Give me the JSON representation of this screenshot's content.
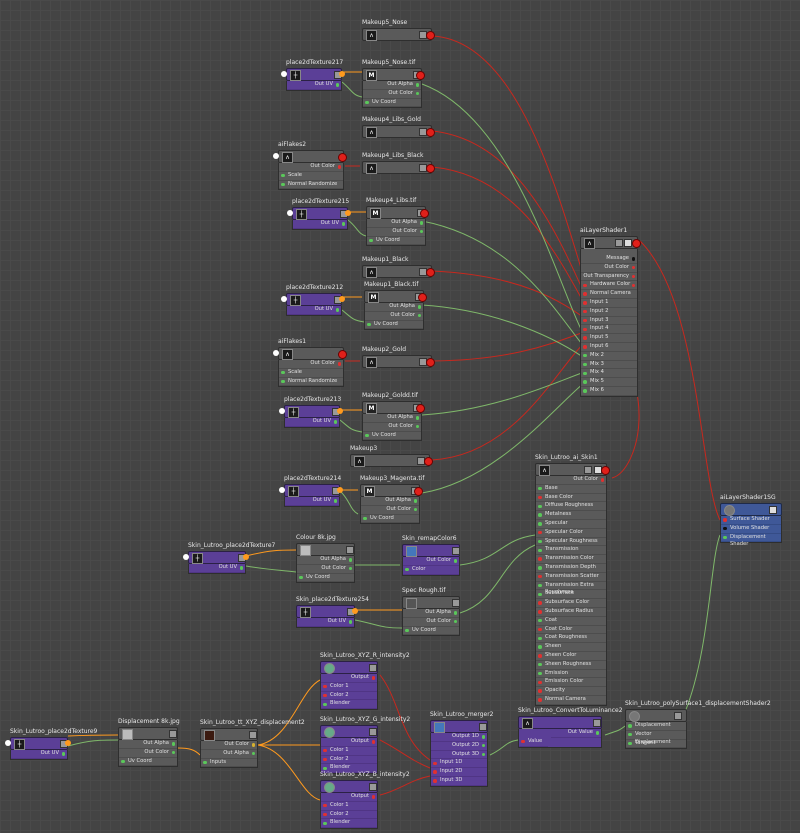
{
  "nodes": {
    "makeup5_nose": {
      "title": "Makeup5_Nose"
    },
    "place2d217": {
      "title": "place2dTexture217",
      "out": "Out UV"
    },
    "makeup5_nose_tif": {
      "title": "Makeup5_Nose.tif",
      "out_alpha": "Out Alpha",
      "out_color": "Out Color",
      "uv": "Uv Coord"
    },
    "makeup4_libs_gold": {
      "title": "Makeup4_Libs_Gold"
    },
    "aiflakes2": {
      "title": "aiFlakes2",
      "out": "Out Color",
      "scale": "Scale",
      "normal_randomize": "Normal Randomize"
    },
    "makeup4_libs_black": {
      "title": "Makeup4_Libs_Black"
    },
    "place2d215": {
      "title": "place2dTexture215",
      "out": "Out UV"
    },
    "makeup4_libs_tif": {
      "title": "Makeup4_Libs.tif",
      "out_alpha": "Out Alpha",
      "out_color": "Out Color",
      "uv": "Uv Coord"
    },
    "makeup1_black": {
      "title": "Makeup1_Black"
    },
    "place2d212": {
      "title": "place2dTexture212",
      "out": "Out UV"
    },
    "makeup1_black_tif": {
      "title": "Makeup1_Black.tif",
      "out_alpha": "Out Alpha",
      "out_color": "Out Color",
      "uv": "Uv Coord"
    },
    "aiflakes1": {
      "title": "aiFlakes1",
      "out": "Out Color",
      "scale": "Scale",
      "normal_randomize": "Normal Randomize"
    },
    "makeup2_gold": {
      "title": "Makeup2_Gold"
    },
    "place2d213": {
      "title": "place2dTexture213",
      "out": "Out UV"
    },
    "makeup2_goldd_tif": {
      "title": "Makeup2_Goldd.tif",
      "out_alpha": "Out Alpha",
      "out_color": "Out Color",
      "uv": "Uv Coord"
    },
    "makeup3": {
      "title": "Makeup3"
    },
    "place2d214": {
      "title": "place2dTexture214",
      "out": "Out UV"
    },
    "makeup3_magenta_tif": {
      "title": "Makeup3_Magenta.tif",
      "out_alpha": "Out Alpha",
      "out_color": "Out Color",
      "uv": "Uv Coord"
    },
    "ailayershader1": {
      "title": "aiLayerShader1",
      "rows": [
        "Message",
        "Out Color",
        "Out Transparency",
        "Hardware Color",
        "Normal Camera",
        "Input 1",
        "Input 2",
        "Input 3",
        "Input 4",
        "Input 5",
        "Input 6",
        "Mix 2",
        "Mix 3",
        "Mix 4",
        "Mix 5",
        "Mix 6"
      ]
    },
    "skin_ai_skin1": {
      "title": "Skin_Lutroo_ai_Skin1",
      "out": "Out Color",
      "rows": [
        "Base",
        "Base Color",
        "Diffuse Roughness",
        "Metalness",
        "Specular",
        "Specular Color",
        "Specular Roughness",
        "Transmission",
        "Transmission Color",
        "Transmission Depth",
        "Transmission Scatter",
        "Transmission Extra Roughness",
        "Subsurface",
        "Subsurface Color",
        "Subsurface Radius",
        "Coat",
        "Coat Color",
        "Coat Roughness",
        "Sheen",
        "Sheen Color",
        "Sheen Roughness",
        "Emission",
        "Emission Color",
        "Opacity",
        "Normal Camera"
      ]
    },
    "ailayershader1sg": {
      "title": "aiLayerShader1SG",
      "rows": [
        "Surface Shader",
        "Volume Shader",
        "Displacement Shader"
      ]
    },
    "skin_place2d7": {
      "title": "Skin_Lutroo_place2dTexture7",
      "out": "Out UV"
    },
    "colour_8k": {
      "title": "Colour 8k.jpg",
      "out_alpha": "Out Alpha",
      "out_color": "Out Color",
      "uv": "Uv Coord"
    },
    "skin_remap6": {
      "title": "Skin_remapColor6",
      "out": "Out Color",
      "color": "Color"
    },
    "skin_place2d254": {
      "title": "Skin_place2dTexture254",
      "out": "Out UV"
    },
    "spec_rough": {
      "title": "Spec Rough.tif",
      "out_alpha": "Out Alpha",
      "out_color": "Out Color",
      "uv": "Uv Coord"
    },
    "skin_place2d9": {
      "title": "Skin_Lutroo_place2dTexture9",
      "out": "Out UV"
    },
    "displacement_8k": {
      "title": "Displacement 8k.jpg",
      "out_alpha": "Out Alpha",
      "out_color": "Out Color",
      "uv": "Uv Coord"
    },
    "skin_tt_xyz": {
      "title": "Skin_Lutroo_tt_XYZ_displacement2",
      "out_color": "Out Color",
      "out_alpha": "Out Alpha",
      "inputs": "Inputs"
    },
    "xyz_r": {
      "title": "Skin_Lutroo_XYZ_R_intensity2",
      "output": "Output",
      "c1": "Color 1",
      "c2": "Color 2",
      "blender": "Blender"
    },
    "xyz_g": {
      "title": "Skin_Lutroo_XYZ_G_intensity2",
      "output": "Output",
      "c1": "Color 1",
      "c2": "Color 2",
      "blender": "Blender"
    },
    "xyz_b": {
      "title": "Skin_Lutroo_XYZ_B_intensity2",
      "output": "Output",
      "c1": "Color 1",
      "c2": "Color 2",
      "blender": "Blender"
    },
    "merger2": {
      "title": "Skin_Lutroo_merger2",
      "rows_out": [
        "Output 1D",
        "Output 2D",
        "Output 3D"
      ],
      "rows_in": [
        "Input 1D",
        "Input 2D",
        "Input 3D"
      ]
    },
    "convert_lum2": {
      "title": "Skin_Lutroo_ConvertToLuminance2",
      "out": "Out Value",
      "value": "Value"
    },
    "poly_disp2": {
      "title": "Skin_Lutroo_polySurface1_displacementShader2",
      "rows": [
        "Displacement",
        "Vector Displacement",
        "Tangent"
      ]
    }
  },
  "colors": {
    "wire_red": "#c8281e",
    "wire_green": "#7fb86a",
    "wire_orange": "#ff9a1e",
    "node_purple": "#5b3f97",
    "node_grey": "#5a5a5a",
    "node_blue": "#3f5898"
  }
}
